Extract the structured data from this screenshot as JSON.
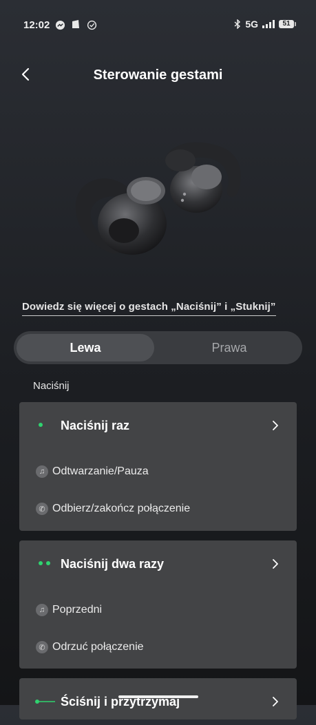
{
  "status": {
    "time": "12:02",
    "network": "5G",
    "battery": "51"
  },
  "header": {
    "title": "Sterowanie gestami"
  },
  "learn_link": "Dowiedz się więcej o gestach „Naciśnij” i „Stuknij”",
  "tabs": [
    {
      "label": "Lewa"
    },
    {
      "label": "Prawa"
    }
  ],
  "section": {
    "label": "Naciśnij"
  },
  "cards": [
    {
      "title": "Naciśnij raz",
      "dots": 1,
      "actions": [
        "Odtwarzanie/Pauza",
        "Odbierz/zakończ połączenie"
      ]
    },
    {
      "title": "Naciśnij dwa razy",
      "dots": 2,
      "actions": [
        "Poprzedni",
        "Odrzuć połączenie"
      ]
    },
    {
      "title": "Ściśnij i przytrzymaj",
      "actions": []
    }
  ],
  "colors": {
    "accent": "#2fd36f",
    "card": "#434446",
    "tab_track": "#3a3c40"
  },
  "icons": [
    "messenger-icon",
    "square-icon",
    "check-circle-icon",
    "bluetooth-icon",
    "signal-icon",
    "battery-icon",
    "back-arrow-icon",
    "chevron-right-icon",
    "music-note-icon",
    "phone-icon"
  ]
}
